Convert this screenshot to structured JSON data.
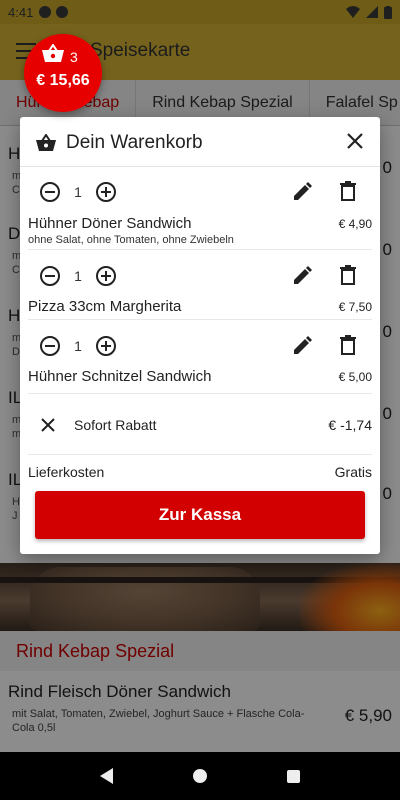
{
  "status_bar": {
    "time": "4:41"
  },
  "app_bar": {
    "title": "Speisekarte"
  },
  "tabs": [
    {
      "label": "Hühner Kebap"
    },
    {
      "label": "Rind Kebap Spezial"
    },
    {
      "label": "Falafel Sp"
    }
  ],
  "background_rows": [
    {
      "initial": "H",
      "sub": [
        "m",
        "C"
      ],
      "price": "0"
    },
    {
      "initial": "D",
      "sub": [
        "m",
        "C"
      ],
      "price": "0"
    },
    {
      "initial": "H",
      "sub": [
        "m",
        "D"
      ],
      "price": "0"
    },
    {
      "initial": "IL",
      "sub": [
        "m",
        "m"
      ],
      "price": "0"
    },
    {
      "initial": "IL",
      "sub": [
        "H",
        "J"
      ],
      "price": "0"
    }
  ],
  "section": {
    "title": "Rind Kebap Spezial"
  },
  "menu_item": {
    "name": "Rind Fleisch Döner Sandwich",
    "description": "mit Salat, Tomaten, Zwiebel, Joghurt Sauce + Flasche Cola-Cola 0,5l",
    "price": "€ 5,90"
  },
  "basket_badge": {
    "count": "3",
    "total": "€ 15,66"
  },
  "cart_dialog": {
    "title": "Dein Warenkorb",
    "lines": [
      {
        "qty": "1",
        "name": "Hühner Döner Sandwich",
        "note": "ohne Salat, ohne Tomaten, ohne Zwiebeln",
        "price": "€ 4,90"
      },
      {
        "qty": "1",
        "name": "Pizza 33cm Margherita",
        "note": "",
        "price": "€ 7,50"
      },
      {
        "qty": "1",
        "name": "Hühner Schnitzel Sandwich",
        "note": "",
        "price": "€ 5,00"
      }
    ],
    "discount": {
      "label": "Sofort Rabatt",
      "amount": "€ -1,74"
    },
    "delivery": {
      "label": "Lieferkosten",
      "value": "Gratis"
    },
    "checkout_label": "Zur Kassa"
  },
  "colors": {
    "accent_red": "#d20000",
    "app_bar_yellow": "#d6b536"
  }
}
